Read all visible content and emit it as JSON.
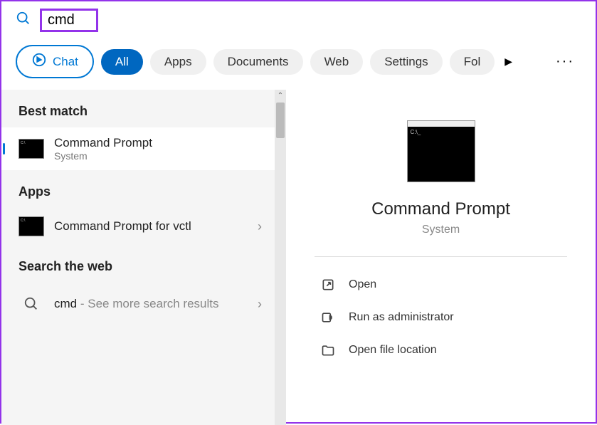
{
  "search": {
    "value": "cmd"
  },
  "filters": {
    "chat": "Chat",
    "items": [
      "All",
      "Apps",
      "Documents",
      "Web",
      "Settings",
      "Fol"
    ],
    "active_index": 0
  },
  "left": {
    "best_match_header": "Best match",
    "best_match": {
      "title": "Command Prompt",
      "subtitle": "System"
    },
    "apps_header": "Apps",
    "apps": [
      {
        "title": "Command Prompt for vctl"
      }
    ],
    "web_header": "Search the web",
    "web": [
      {
        "query": "cmd",
        "suffix": " - See more search results"
      }
    ]
  },
  "preview": {
    "title": "Command Prompt",
    "subtitle": "System",
    "actions": [
      {
        "label": "Open",
        "icon": "open"
      },
      {
        "label": "Run as administrator",
        "icon": "admin"
      },
      {
        "label": "Open file location",
        "icon": "folder"
      }
    ]
  }
}
